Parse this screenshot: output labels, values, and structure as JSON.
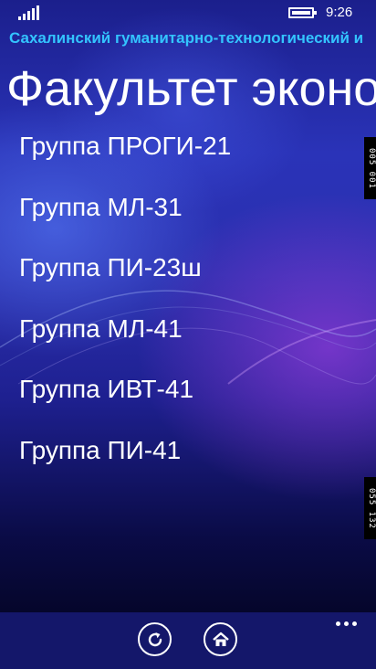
{
  "status": {
    "time": "9:26",
    "icons": [
      "signal-icon",
      "battery-icon"
    ]
  },
  "header": {
    "subtitle": "Сахалинский гуманитарно-технологический и",
    "title": "Факультет эконо"
  },
  "groups": [
    {
      "label": "Группа ПРОГИ-21"
    },
    {
      "label": "Группа МЛ-31"
    },
    {
      "label": "Группа ПИ-23ш"
    },
    {
      "label": "Группа МЛ-41"
    },
    {
      "label": "Группа ИВТ-41"
    },
    {
      "label": "Группа ПИ-41"
    }
  ],
  "edge_tags": [
    "005 001",
    "055 132"
  ],
  "appbar": {
    "buttons": [
      "refresh-icon",
      "home-icon"
    ],
    "more": "more-icon"
  },
  "colors": {
    "accent": "#33c4ff",
    "appbar": "#14176a"
  }
}
